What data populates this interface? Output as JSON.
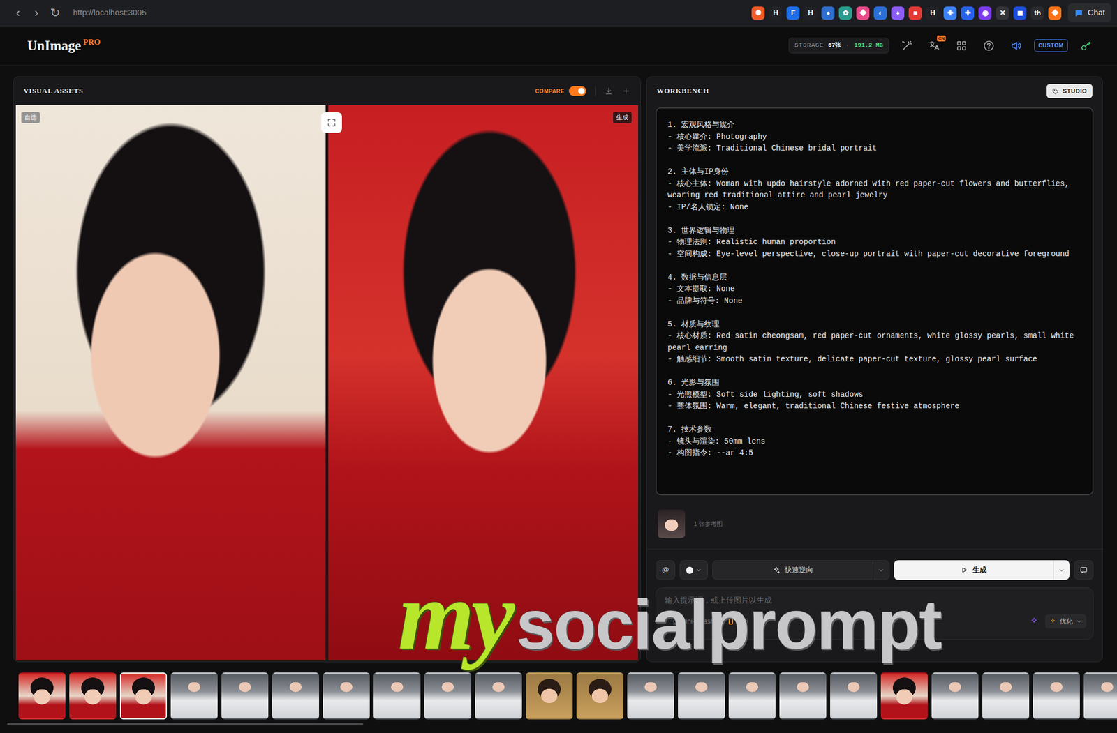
{
  "browser": {
    "nav": [
      "‹",
      "›",
      "↻"
    ],
    "url": "http://localhost:3005",
    "extensions": [
      {
        "glyph": "✺",
        "color": "#f05a28"
      },
      {
        "glyph": "H",
        "color": "#222226"
      },
      {
        "glyph": "F",
        "color": "#1e6fe8"
      },
      {
        "glyph": "H",
        "color": "#222226"
      },
      {
        "glyph": "●",
        "color": "#2f6fd0"
      },
      {
        "glyph": "✿",
        "color": "#2a9d8f"
      },
      {
        "glyph": "◆",
        "color": "#e84a8a"
      },
      {
        "glyph": "◐",
        "color": "#2b6fd6"
      },
      {
        "glyph": "♦",
        "color": "#8b5cf6"
      },
      {
        "glyph": "■",
        "color": "#e53935"
      },
      {
        "glyph": "H",
        "color": "#222226"
      },
      {
        "glyph": "✚",
        "color": "#3b82f6"
      },
      {
        "glyph": "✚",
        "color": "#2563eb"
      },
      {
        "glyph": "◉",
        "color": "#7c3aed"
      },
      {
        "glyph": "✕",
        "color": "#333338"
      },
      {
        "glyph": "◼",
        "color": "#1d4ed8"
      },
      {
        "glyph": "th",
        "color": "#2a2a2e"
      },
      {
        "glyph": "◆",
        "color": "#f97316"
      }
    ],
    "chat": "Chat"
  },
  "header": {
    "logo": "UnImage",
    "badge": "PRO",
    "storage": {
      "label": "STORAGE",
      "count": "67张",
      "sep": "·",
      "size": "191.2 MB"
    },
    "lang_badge": "CN",
    "custom": "CUSTOM"
  },
  "assets": {
    "title": "VISUAL ASSETS",
    "compare": {
      "label": "COMPARE",
      "on": true
    },
    "left_tag": "自选",
    "right_tag": "生成"
  },
  "workbench": {
    "title": "WORKBENCH",
    "studio": "STUDIO",
    "prompt": [
      {
        "heading": "1. 宏观风格与媒介",
        "lines": [
          "- 核心媒介: Photography",
          "- 美学流派: Traditional Chinese bridal portrait"
        ]
      },
      {
        "heading": "2. 主体与IP身份",
        "lines": [
          "- 核心主体: Woman with updo hairstyle adorned with red paper-cut flowers and butterflies, wearing red traditional attire and pearl jewelry",
          "- IP/名人锁定: None"
        ]
      },
      {
        "heading": "3. 世界逻辑与物理",
        "lines": [
          "- 物理法则: Realistic human proportion",
          "- 空间构成: Eye-level perspective, close-up portrait with paper-cut decorative foreground"
        ]
      },
      {
        "heading": "4. 数据与信息层",
        "lines": [
          "- 文本提取: None",
          "- 品牌与符号: None"
        ]
      },
      {
        "heading": "5. 材质与纹理",
        "lines": [
          "- 核心材质: Red satin cheongsam, red paper-cut ornaments, white glossy pearls, small white pearl earring",
          "- 触感细节: Smooth satin texture, delicate paper-cut texture, glossy pearl surface"
        ]
      },
      {
        "heading": "6. 光影与氛围",
        "lines": [
          "- 光照模型: Soft side lighting, soft shadows",
          "- 整体氛围: Warm, elegant, traditional Chinese festive atmosphere"
        ]
      },
      {
        "heading": "7. 技术参数",
        "lines": [
          "- 镜头与渲染: 50mm lens",
          "- 构图指令: --ar 4:5"
        ]
      }
    ],
    "ref_label": "1 张参考图",
    "at": "@",
    "reverse": "快速逆向",
    "generate": "生成",
    "input_placeholder": "输入提示词，或上传图片以生成",
    "add": "+",
    "model": "gemini-3-flash",
    "ratio": "9:16",
    "optimize": "优化"
  },
  "thumbnails": [
    {
      "kind": "bride",
      "selected": false
    },
    {
      "kind": "bride",
      "selected": false
    },
    {
      "kind": "bride",
      "selected": true
    },
    {
      "kind": "nurse",
      "selected": false
    },
    {
      "kind": "nurse",
      "selected": false
    },
    {
      "kind": "nurse",
      "selected": false
    },
    {
      "kind": "nurse",
      "selected": false
    },
    {
      "kind": "nurse",
      "selected": false
    },
    {
      "kind": "nurse",
      "selected": false
    },
    {
      "kind": "nurse",
      "selected": false
    },
    {
      "kind": "warm",
      "selected": false
    },
    {
      "kind": "warm",
      "selected": false
    },
    {
      "kind": "nurse",
      "selected": false
    },
    {
      "kind": "nurse",
      "selected": false
    },
    {
      "kind": "nurse",
      "selected": false
    },
    {
      "kind": "nurse",
      "selected": false
    },
    {
      "kind": "nurse",
      "selected": false
    },
    {
      "kind": "bride",
      "selected": false
    },
    {
      "kind": "nurse",
      "selected": false
    },
    {
      "kind": "nurse",
      "selected": false
    },
    {
      "kind": "nurse",
      "selected": false
    },
    {
      "kind": "nurse",
      "selected": false
    }
  ],
  "watermark": {
    "prefix": "my",
    "text": "socialprompt"
  }
}
